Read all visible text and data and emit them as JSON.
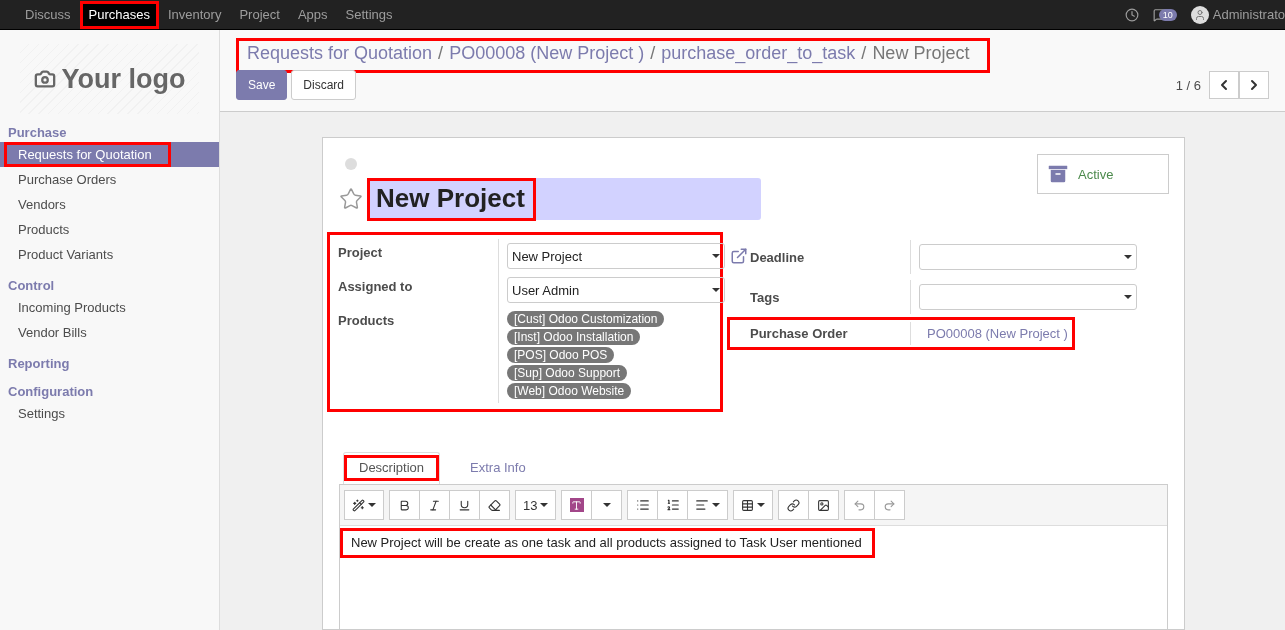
{
  "top_menu": [
    {
      "label": "Discuss",
      "selected": false,
      "highlighted": false
    },
    {
      "label": "Purchases",
      "selected": true,
      "highlighted": true
    },
    {
      "label": "Inventory",
      "selected": false,
      "highlighted": false
    },
    {
      "label": "Project",
      "selected": false,
      "highlighted": false
    },
    {
      "label": "Apps",
      "selected": false,
      "highlighted": false
    },
    {
      "label": "Settings",
      "selected": false,
      "highlighted": false
    }
  ],
  "user": {
    "name": "Administrato",
    "message_count": "10"
  },
  "sidebar": {
    "logo_text": "Your logo",
    "sections": [
      {
        "title": "Purchase",
        "items": [
          {
            "label": "Requests for Quotation",
            "selected": true,
            "highlighted": true
          },
          {
            "label": "Purchase Orders",
            "selected": false,
            "highlighted": false
          },
          {
            "label": "Vendors",
            "selected": false,
            "highlighted": false
          },
          {
            "label": "Products",
            "selected": false,
            "highlighted": false
          },
          {
            "label": "Product Variants",
            "selected": false,
            "highlighted": false
          }
        ]
      },
      {
        "title": "Control",
        "items": [
          {
            "label": "Incoming Products",
            "selected": false,
            "highlighted": false
          },
          {
            "label": "Vendor Bills",
            "selected": false,
            "highlighted": false
          }
        ]
      },
      {
        "title": "Reporting"
      },
      {
        "title": "Configuration",
        "items": [
          {
            "label": "Settings",
            "selected": false,
            "highlighted": false
          }
        ]
      }
    ]
  },
  "breadcrumbs": {
    "highlighted": true,
    "separator": "/",
    "items": [
      {
        "label": "Requests for Quotation",
        "link": true
      },
      {
        "label": "PO00008 (New Project )",
        "link": true
      },
      {
        "label": "purchase_order_to_task",
        "link": true
      },
      {
        "label": "New Project",
        "link": false
      }
    ]
  },
  "buttons": [
    "Save",
    "Discard"
  ],
  "pager": "1 / 6",
  "form": {
    "starred": false,
    "title": {
      "value": "New Project",
      "highlighted": true
    },
    "active_label": "Active",
    "left_group": {
      "highlighted": true,
      "fields": [
        {
          "kind": "select",
          "label": "Project",
          "value": "New Project"
        },
        {
          "kind": "select",
          "label": "Assigned to",
          "value": "User Admin"
        },
        {
          "kind": "tags",
          "label": "Products",
          "tags": [
            "[Cust] Odoo Customization",
            "[Inst] Odoo Installation",
            "[POS] Odoo POS",
            "[Sup] Odoo Support",
            "[Web] Odoo Website"
          ]
        }
      ]
    },
    "right_fields": [
      {
        "kind": "select",
        "label": "Deadline",
        "highlighted": false
      },
      {
        "kind": "select",
        "label": "Tags",
        "highlighted": false
      },
      {
        "kind": "link",
        "label": "Purchase Order",
        "value": "PO00008 (New Project )",
        "highlighted": true
      }
    ],
    "tabs": [
      {
        "label": "Description",
        "selected": true,
        "highlighted": true
      },
      {
        "label": "Extra Info",
        "selected": false,
        "highlighted": false
      }
    ],
    "editor": {
      "font_size": "13",
      "text": "New Project will be create as one task and all products assigned to Task User mentioned",
      "highlighted": true
    }
  }
}
